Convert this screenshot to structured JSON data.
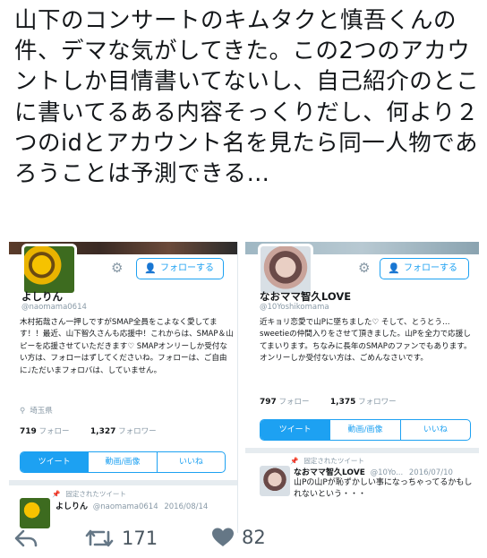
{
  "tweet": {
    "text": "山下のコンサートのキムタクと慎吾くんの件、デマな気がしてきた。この2つのアカウントしか目情書いてないし、自己紹介のとこに書いてるある内容そっくりだし、何より２つのidとアカウント名を見たら同一人物であろうことは予測できる…"
  },
  "left_profile": {
    "follow_label": "フォローする",
    "name": "よしりん",
    "handle": "@naomama0614",
    "bio": "木村拓哉さん一押しですがSMAP全員をこよなく愛してます！！最近、山下智久さんも応援中！これからは、SMAP＆山ピーを応援させていただきます♡ SMAPオンリーしか受付ない方は、フォローはずしてくださいね。フォローは、ご自由に♩ただいまフォロバは、していません。",
    "location": "埼玉県",
    "following_count": "719",
    "following_label": "フォロー",
    "followers_count": "1,327",
    "followers_label": "フォロワー",
    "tabs": [
      "ツイート",
      "動画/画像",
      "いいね"
    ],
    "pinned_label": "固定されたツイート",
    "pinned_name": "よしりん",
    "pinned_handle": "@naomama0614",
    "pinned_date": "2016/08/14"
  },
  "right_profile": {
    "follow_label": "フォローする",
    "name": "なおママ智久LOVE",
    "handle": "@10Yoshikomama",
    "bio": "近キョリ恋愛で山Pに墜ちました♡ そして、とうとう…sweetieの仲間入りをさせて頂きました。山Pを全力で応援してまいります。ちなみに長年のSMAPのファンでもあります。オンリーしか受付ない方は、ごめんなさいです。",
    "following_count": "797",
    "following_label": "フォロー",
    "followers_count": "1,375",
    "followers_label": "フォロワー",
    "tabs": [
      "ツイート",
      "動画/画像",
      "いいね"
    ],
    "pinned_label": "固定されたツイート",
    "pinned_name": "なおママ智久LOVE",
    "pinned_handle": "@10Yo...",
    "pinned_date": "2016/07/10",
    "pinned_text": "山Pの山Pが恥ずかしい事になっちゃってるかもしれないという・・・"
  },
  "actions": {
    "retweet_count": "171",
    "like_count": "82",
    "icons": [
      "reply-icon",
      "retweet-icon",
      "heart-icon"
    ]
  },
  "colors": {
    "accent": "#1da1f2",
    "muted": "#8899a6",
    "text": "#14171a"
  }
}
